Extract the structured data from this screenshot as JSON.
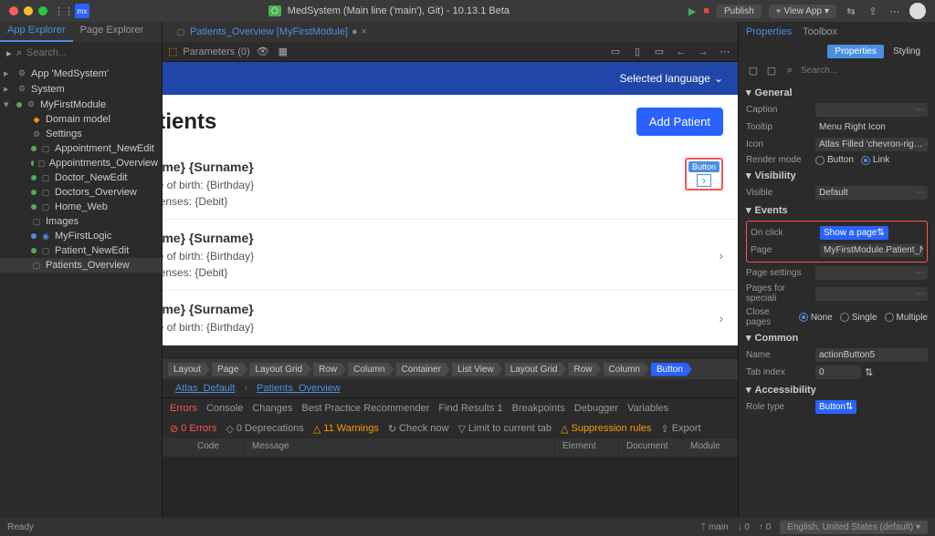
{
  "titlebar": {
    "title": "MedSystem (Main line ('main'), Git) - 10.13.1 Beta",
    "publish": "Publish",
    "viewapp": "View App"
  },
  "lefttabs": {
    "app": "App Explorer",
    "page": "Page Explorer"
  },
  "search": {
    "placeholder": "Search..."
  },
  "tree": {
    "app": "App 'MedSystem'",
    "system": "System",
    "module": "MyFirstModule",
    "items": [
      "Domain model",
      "Settings",
      "Appointment_NewEdit",
      "Appointments_Overview",
      "Doctor_NewEdit",
      "Doctors_Overview",
      "Home_Web",
      "Images",
      "MyFirstLogic",
      "Patient_NewEdit",
      "Patients_Overview"
    ]
  },
  "doctab": {
    "label": "Patients_Overview [MyFirstModule]"
  },
  "params": {
    "label": "Parameters (0)"
  },
  "canvas": {
    "lang": "Selected language",
    "title": "Patients",
    "addbtn": "Add Patient",
    "card": {
      "name": "{Name} {Surname}",
      "dob": "Date of birth: {Birthday}",
      "expenses": "Expenses: {Debit}",
      "btnlabel": "Button"
    }
  },
  "breadcrumb": [
    "Layout",
    "Page",
    "Layout Grid",
    "Row",
    "Column",
    "Container",
    "List View",
    "Layout Grid",
    "Row",
    "Column",
    "Button"
  ],
  "breadcrumb2": {
    "a": "Atlas_Default",
    "b": "Patients_Overview"
  },
  "btabs": [
    "Errors",
    "Console",
    "Changes",
    "Best Practice Recommender",
    "Find Results 1",
    "Breakpoints",
    "Debugger",
    "Variables"
  ],
  "btool": {
    "errors": "0 Errors",
    "deprecations": "0 Deprecations",
    "warnings": "11 Warnings",
    "check": "Check now",
    "limit": "Limit to current tab",
    "supp": "Suppression rules",
    "export": "Export"
  },
  "gcols": [
    "",
    "Code",
    "Message",
    "Element",
    "Document",
    "Module"
  ],
  "rtabs": {
    "props": "Properties",
    "toolbox": "Toolbox"
  },
  "subtabs": {
    "props": "Properties",
    "styling": "Styling"
  },
  "props": {
    "general": "General",
    "caption": "Caption",
    "tooltip_l": "Tooltip",
    "tooltip_v": "Menu Right Icon",
    "icon_l": "Icon",
    "icon_v": "Atlas Filled 'chevron-rig…",
    "render_l": "Render mode",
    "render_opts": {
      "a": "Button",
      "b": "Link"
    },
    "visibility": "Visibility",
    "visible_l": "Visible",
    "visible_v": "Default",
    "events": "Events",
    "onclick_l": "On click",
    "onclick_v": "Show a page",
    "page_l": "Page",
    "page_v": "MyFirstModule.Patient_Ne…",
    "pagesettings_l": "Page settings",
    "pagesfor_l": "Pages for speciali",
    "closepages_l": "Close pages",
    "close_opts": {
      "a": "None",
      "b": "Single",
      "c": "Multiple"
    },
    "common": "Common",
    "name_l": "Name",
    "name_v": "actionButton5",
    "tabindex_l": "Tab index",
    "tabindex_v": "0",
    "accessibility": "Accessibility",
    "roletype_l": "Role type",
    "roletype_v": "Button"
  },
  "status": {
    "ready": "Ready",
    "branch": "main",
    "down": "0",
    "up": "0",
    "lang": "English, United States (default)"
  }
}
